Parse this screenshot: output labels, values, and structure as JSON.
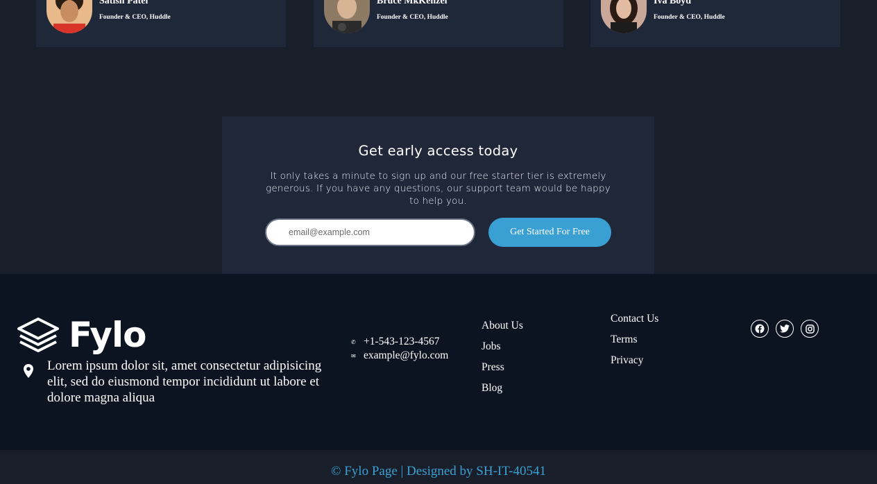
{
  "testimonials": [
    {
      "name": "Satish Patel",
      "role": "Founder & CEO, Huddle"
    },
    {
      "name": "Bruce MkKenzel",
      "role": "Founder & CEO, Huddle"
    },
    {
      "name": "Iva Boyd",
      "role": "Founder & CEO, Huddle"
    }
  ],
  "cta": {
    "title": "Get early access today",
    "description": "It only takes a minute to sign up and our free starter tier is extremely generous. If you have any questions, our support team would be happy to help you.",
    "email_placeholder": "email@example.com",
    "button_label": "Get Started For Free"
  },
  "footer": {
    "logo_text": "Fylo",
    "address": "Lorem ipsum dolor sit, amet consectetur adipisicing elit, sed do eiusmond tempor incididunt ut labore et dolore magna aliqua",
    "phone": "+1-543-123-4567",
    "email": "example@fylo.com",
    "links_col1": [
      "About Us",
      "Jobs",
      "Press",
      "Blog"
    ],
    "links_col2": [
      "Contact Us",
      "Terms",
      "Privacy"
    ],
    "socials": [
      "facebook-icon",
      "twitter-icon",
      "instagram-icon"
    ]
  },
  "copyright": "© Fylo Page | Designed by SH-IT-40541",
  "colors": {
    "accent": "#3aa0d4",
    "page_bg": "#181f2a",
    "card_bg": "#1f2839",
    "footer_bg": "#0c1421"
  }
}
